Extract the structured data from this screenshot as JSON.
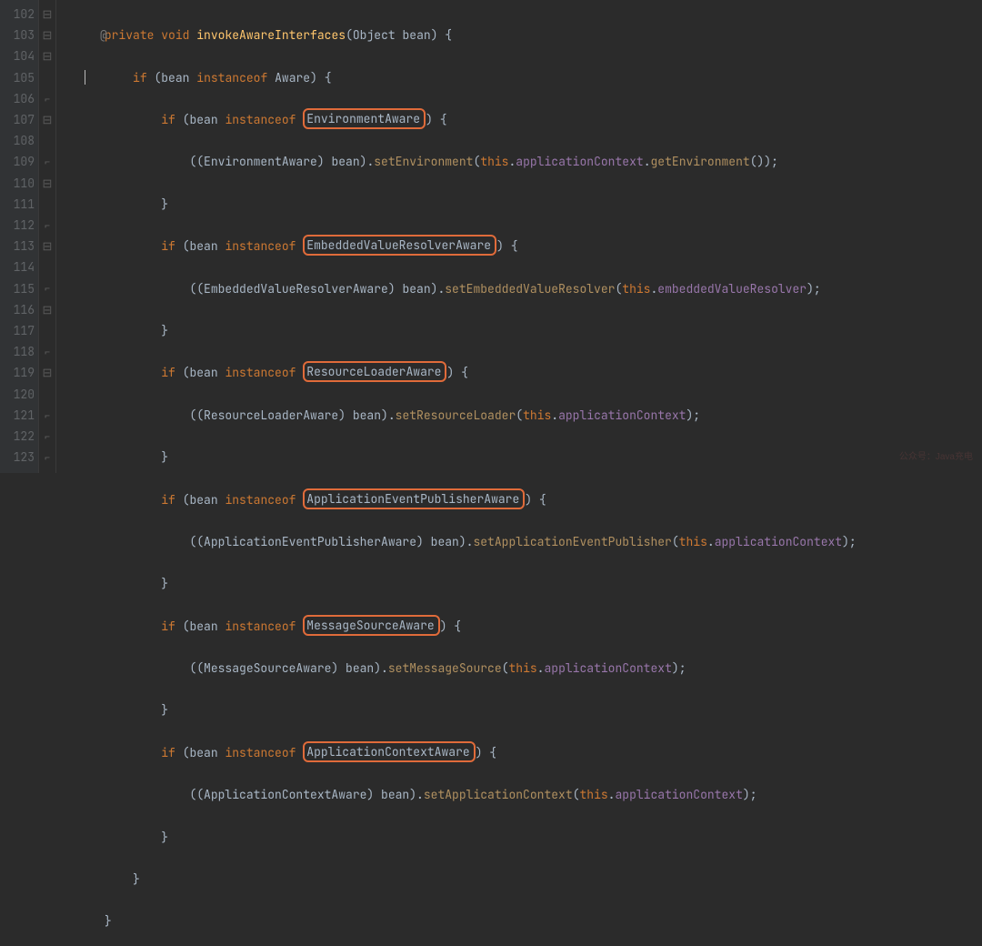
{
  "gutter": {
    "lines": [
      "102",
      "103",
      "104",
      "105",
      "106",
      "107",
      "108",
      "109",
      "110",
      "111",
      "112",
      "113",
      "114",
      "115",
      "116",
      "117",
      "118",
      "119",
      "120",
      "121",
      "122",
      "123"
    ]
  },
  "annot": {
    "override": "@"
  },
  "fold": {
    "glyphs": [
      "⊟",
      "⊟",
      "⊟",
      "",
      "⌐",
      "⊟",
      "",
      "⌐",
      "⊟",
      "",
      "⌐",
      "⊟",
      "",
      "⌐",
      "⊟",
      "",
      "⌐",
      "⊟",
      "",
      "⌐",
      "⌐",
      "⌐"
    ]
  },
  "code": {
    "kw_private": "private",
    "kw_void": "void",
    "method_name": "invokeAwareInterfaces",
    "param_type": "Object",
    "param_name": "bean",
    "kw_if": "if",
    "kw_instanceof": "instanceof",
    "kw_this": "this",
    "type_Aware": "Aware",
    "type_EnvironmentAware": "EnvironmentAware",
    "type_EmbeddedValueResolverAware": "EmbeddedValueResolverAware",
    "type_ResourceLoaderAware": "ResourceLoaderAware",
    "type_ApplicationEventPublisherAware": "ApplicationEventPublisherAware",
    "type_MessageSourceAware": "MessageSourceAware",
    "type_ApplicationContextAware": "ApplicationContextAware",
    "call_setEnvironment": "setEnvironment",
    "call_getEnvironment": "getEnvironment",
    "call_setEmbeddedValueResolver": "setEmbeddedValueResolver",
    "call_setResourceLoader": "setResourceLoader",
    "call_setApplicationEventPublisher": "setApplicationEventPublisher",
    "call_setMessageSource": "setMessageSource",
    "call_setApplicationContext": "setApplicationContext",
    "field_applicationContext": "applicationContext",
    "field_embeddedValueResolver": "embeddedValueResolver",
    "var_bean": "bean"
  },
  "watermark": "公众号：Java充电"
}
